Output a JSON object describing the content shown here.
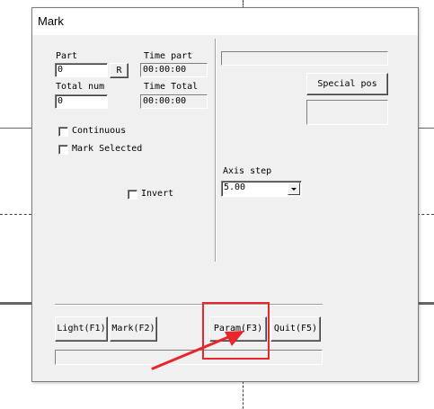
{
  "window": {
    "title": "Mark"
  },
  "left_panel": {
    "part_label": "Part",
    "part_value": "0",
    "reset_button": "R",
    "time_part_label": "Time part",
    "time_part_value": "00:00:00",
    "total_num_label": "Total num",
    "total_num_value": "0",
    "time_total_label": "Time Total",
    "time_total_value": "00:00:00",
    "continuous_label": "Continuous",
    "mark_selected_label": "Mark Selected",
    "invert_label": "Invert"
  },
  "right_panel": {
    "top_field_value": "",
    "special_pos_button": "Special pos",
    "special_pos_field_value": "",
    "axis_step_label": "Axis step",
    "axis_step_value": "5.00"
  },
  "buttons": {
    "light": "Light(F1)",
    "mark": "Mark(F2)",
    "param": "Param(F3)",
    "quit": "Quit(F5)"
  },
  "status_bar": {
    "value": ""
  },
  "annotation": {
    "color": "#e8262b"
  }
}
